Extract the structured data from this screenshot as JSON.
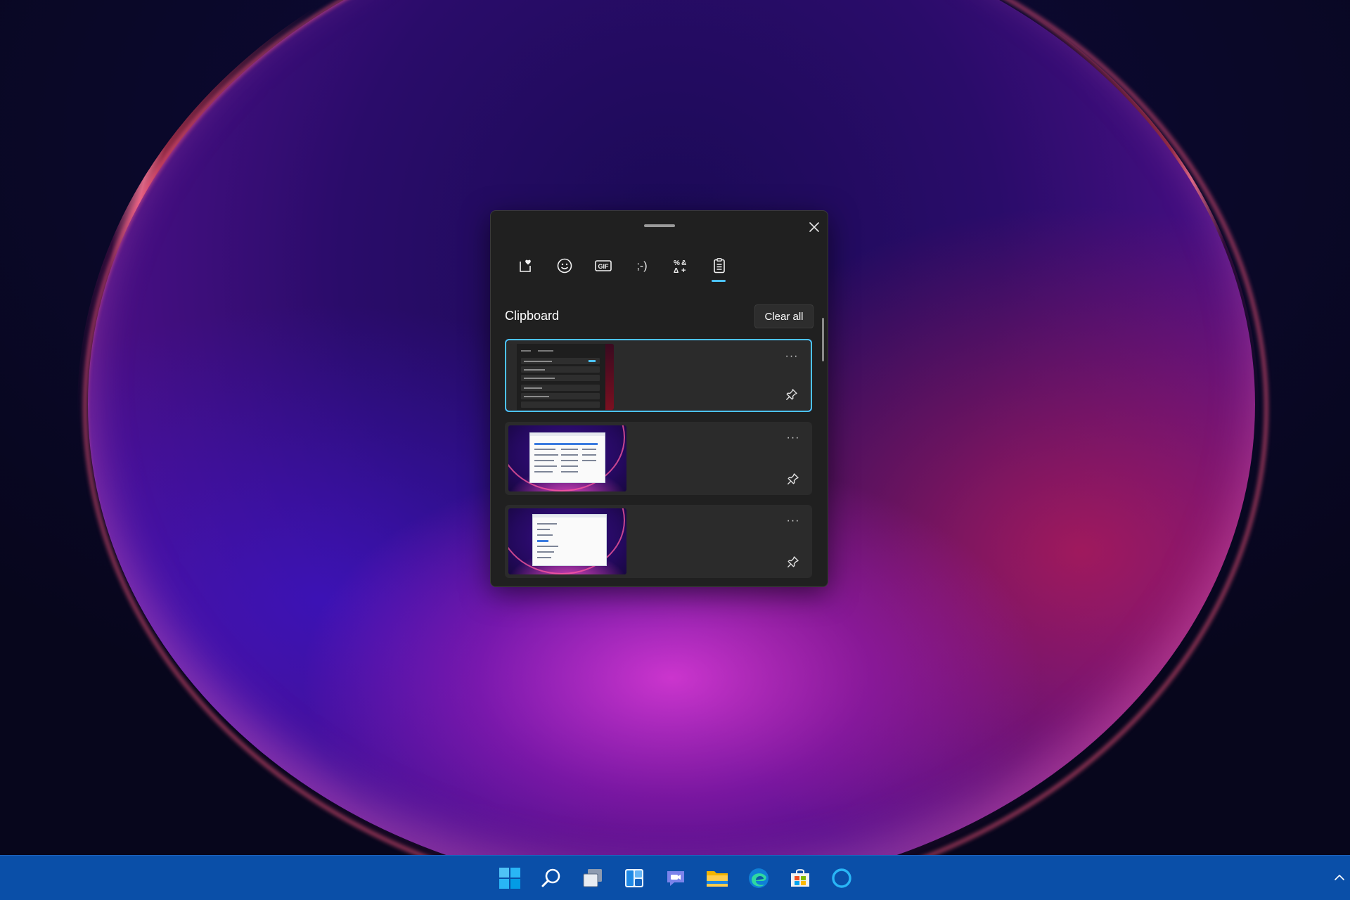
{
  "panel": {
    "section_title": "Clipboard",
    "clear_all_label": "Clear all",
    "tabs": [
      {
        "icon": "favorites-heart-icon",
        "active": false
      },
      {
        "icon": "emoji-icon",
        "active": false
      },
      {
        "icon": "gif-icon",
        "label": "GIF",
        "active": false
      },
      {
        "icon": "kaomoji-icon",
        "label": ";-)",
        "active": false
      },
      {
        "icon": "symbols-icon",
        "active": false
      },
      {
        "icon": "clipboard-icon",
        "active": true
      }
    ],
    "items": [
      {
        "type": "image",
        "thumbnail": "dark-settings-window",
        "selected": true,
        "more_label": "···"
      },
      {
        "type": "image",
        "thumbnail": "desktop-with-file-explorer",
        "selected": false,
        "more_label": "···"
      },
      {
        "type": "image",
        "thumbnail": "desktop-with-notepad",
        "selected": false,
        "more_label": "···"
      }
    ]
  },
  "taskbar": {
    "icons": [
      "start-icon",
      "search-icon",
      "task-view-icon",
      "widgets-icon",
      "teams-chat-icon",
      "file-explorer-icon",
      "edge-icon",
      "store-icon",
      "cortana-icon"
    ]
  },
  "colors": {
    "accent": "#4cc2ff",
    "panel_bg": "#202020",
    "item_bg": "#2b2b2b",
    "taskbar_bg": "#0a4fa8"
  }
}
